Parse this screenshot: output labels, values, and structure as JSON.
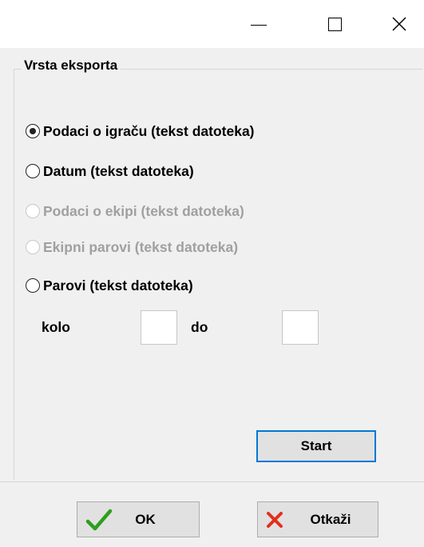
{
  "window": {
    "controls": {
      "minimize": "minimize-icon",
      "maximize": "maximize-icon",
      "close": "close-icon"
    }
  },
  "group": {
    "title": "Vrsta eksporta",
    "options": [
      {
        "label": "Podaci o igraču (tekst datoteka)",
        "selected": true,
        "enabled": true
      },
      {
        "label": "Datum (tekst datoteka)",
        "selected": false,
        "enabled": true
      },
      {
        "label": "Podaci o ekipi (tekst datoteka)",
        "selected": false,
        "enabled": false
      },
      {
        "label": "Ekipni parovi (tekst datoteka)",
        "selected": false,
        "enabled": false
      },
      {
        "label": "Parovi (tekst datoteka)",
        "selected": false,
        "enabled": true
      }
    ],
    "range": {
      "from_label": "kolo",
      "from_value": "",
      "to_label": "do",
      "to_value": ""
    },
    "start_label": "Start"
  },
  "footer": {
    "ok_label": "OK",
    "cancel_label": "Otkaži",
    "ok_icon": "check-icon",
    "cancel_icon": "x-icon"
  },
  "colors": {
    "check": "#2e9e1f",
    "cancel_x": "#e0301e",
    "focus_border": "#0078d7",
    "disabled_text": "#a0a0a0"
  }
}
